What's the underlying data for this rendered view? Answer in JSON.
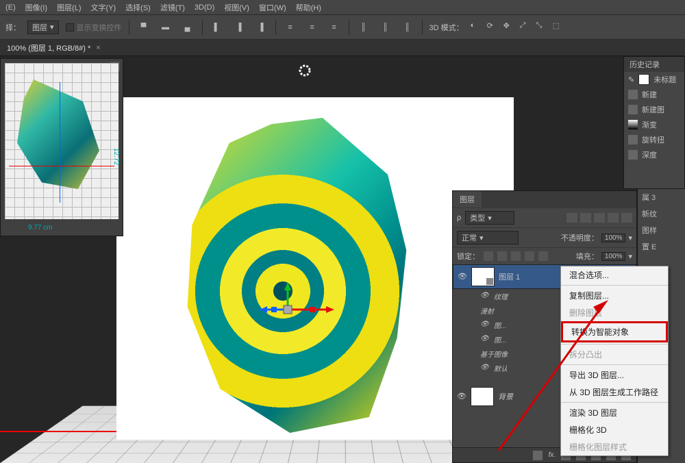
{
  "menu": [
    "(E)",
    "图像(I)",
    "图层(L)",
    "文字(Y)",
    "选择(S)",
    "滤镜(T)",
    "3D(D)",
    "视图(V)",
    "窗口(W)",
    "帮助(H)"
  ],
  "opts": {
    "transform_label": "择：",
    "layer_sel": "图层",
    "show_controls": "显示变换控件",
    "mode_label": "3D 模式："
  },
  "tab": {
    "title": "100% (图层 1, RGB/8#) *"
  },
  "nav": {
    "dim_x": "9.77 cm",
    "dim_y": "12.72"
  },
  "history": {
    "title": "历史记录",
    "items": [
      "未标题",
      "新建",
      "新建图",
      "渐变",
      "旋转扭",
      "深度"
    ]
  },
  "rstrip": [
    "属 3",
    "新纹",
    "图样",
    "置 E"
  ],
  "layers": {
    "tab": "图层",
    "type_label": "类型",
    "blend": "正常",
    "opacity_label": "不透明度：",
    "opacity_val": "100%",
    "lock_label": "锁定：",
    "fill_label": "填充：",
    "fill_val": "100%",
    "items": [
      {
        "name": "图层 1"
      },
      {
        "name": "纹理",
        "sub": true
      },
      {
        "name": "漫射",
        "sub": true,
        "italic": true
      },
      {
        "name": "图...",
        "sub": true
      },
      {
        "name": "图...",
        "sub": true
      },
      {
        "name": "基于图像",
        "sub": true,
        "italic": true
      },
      {
        "name": "默认",
        "sub": true
      }
    ],
    "bg": "背景"
  },
  "ctx": {
    "items": [
      {
        "label": "混合选项..."
      },
      {
        "sep": true
      },
      {
        "label": "复制图层..."
      },
      {
        "label": "删除图层",
        "disabled": true
      },
      {
        "label": "转换为智能对象",
        "boxed": true
      },
      {
        "sep": true
      },
      {
        "label": "拆分凸出",
        "disabled": true
      },
      {
        "sep": true
      },
      {
        "label": "导出 3D 图层..."
      },
      {
        "label": "从 3D 图层生成工作路径"
      },
      {
        "sep": true
      },
      {
        "label": "渲染 3D 图层"
      },
      {
        "label": "栅格化 3D"
      },
      {
        "label": "栅格化图层样式",
        "disabled": true
      }
    ]
  }
}
